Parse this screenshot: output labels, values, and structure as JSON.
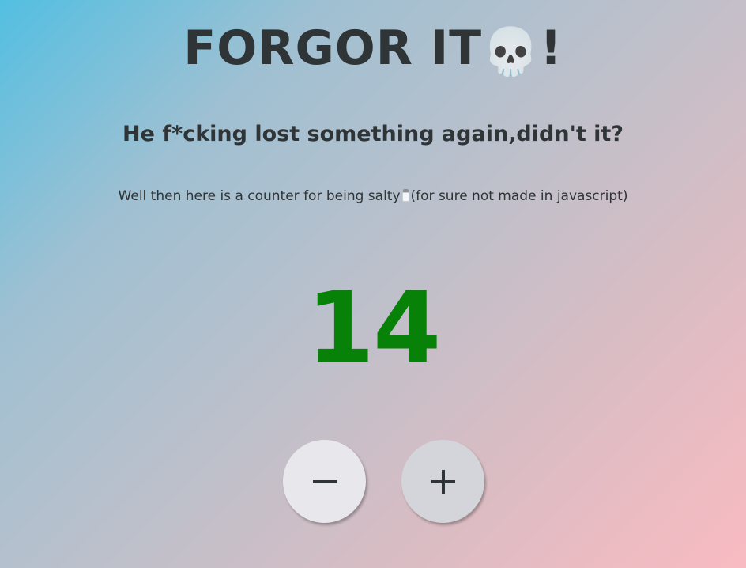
{
  "page": {
    "title_text": "FORGOR IT",
    "title_suffix": "!",
    "title_emoji": "💀",
    "subtitle": "He f*cking lost something again,didn't it?",
    "description_before": "Well then here is a counter for being salty",
    "description_after": "(for sure not made in javascript)",
    "counter_value": "14"
  },
  "icons": {
    "title_icon": "skull-icon",
    "description_icon": "salt-shaker-icon",
    "decrement_icon": "minus-icon",
    "increment_icon": "plus-icon"
  },
  "controls": {
    "decrement": "−",
    "increment": "+"
  },
  "colors": {
    "text": "#2f3437",
    "counter": "#078107",
    "gradient_start": "#53bfe2",
    "gradient_end": "#f9bbc2",
    "button_minus_bg": "#e8e8ec",
    "button_plus_bg": "#d4d5da"
  }
}
